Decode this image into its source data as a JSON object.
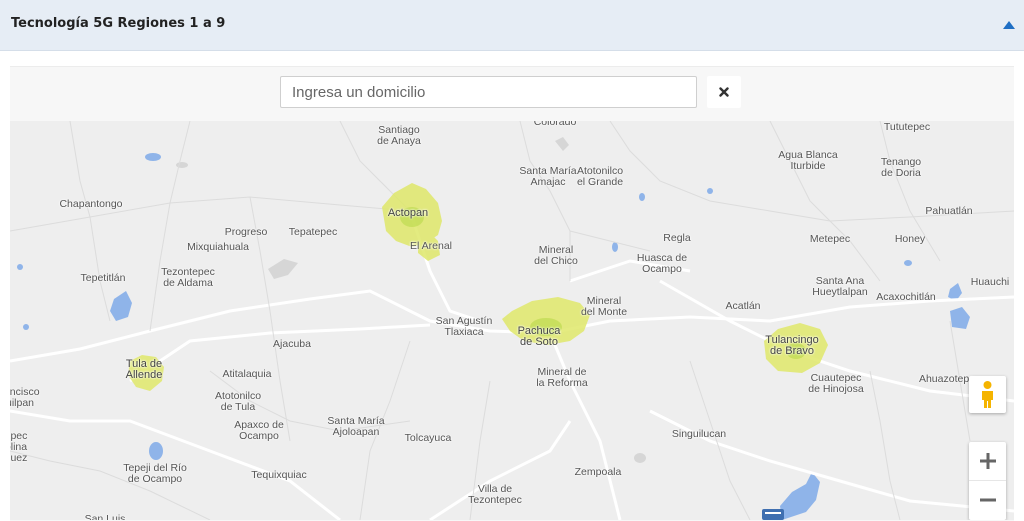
{
  "section": {
    "title": "Tecnología 5G Regiones 1 a 9"
  },
  "search": {
    "placeholder": "Ingresa un domicilio"
  },
  "map": {
    "coverage_color": "#d9e25a",
    "places": [
      {
        "name": "Santiago\nde Anaya",
        "kind": "town"
      },
      {
        "name": "Colorado",
        "kind": "town"
      },
      {
        "name": "Tututepec",
        "kind": "town"
      },
      {
        "name": "Agua Blanca\nIturbide",
        "kind": "town"
      },
      {
        "name": "Tenango\nde Doria",
        "kind": "town"
      },
      {
        "name": "Santa María\nAmajac",
        "kind": "town"
      },
      {
        "name": "Atotonilco\nel Grande",
        "kind": "town"
      },
      {
        "name": "Chapantongo",
        "kind": "town"
      },
      {
        "name": "Actopan",
        "kind": "city"
      },
      {
        "name": "Pahuatlán",
        "kind": "town"
      },
      {
        "name": "Progreso",
        "kind": "town"
      },
      {
        "name": "Tepatepec",
        "kind": "town"
      },
      {
        "name": "El Arenal",
        "kind": "town"
      },
      {
        "name": "Regla",
        "kind": "town"
      },
      {
        "name": "Metepec",
        "kind": "town"
      },
      {
        "name": "Honey",
        "kind": "town"
      },
      {
        "name": "Mixquiahuala",
        "kind": "town"
      },
      {
        "name": "Mineral\ndel Chico",
        "kind": "town"
      },
      {
        "name": "Huasca de\nOcampo",
        "kind": "town"
      },
      {
        "name": "Tepetitlán",
        "kind": "town"
      },
      {
        "name": "Tezontepec\nde Aldama",
        "kind": "town"
      },
      {
        "name": "Santa Ana\nHueytlalpan",
        "kind": "town"
      },
      {
        "name": "Huauchi",
        "kind": "town"
      },
      {
        "name": "Acaxochitlán",
        "kind": "town"
      },
      {
        "name": "Mineral\ndel Monte",
        "kind": "town"
      },
      {
        "name": "Acatlán",
        "kind": "town"
      },
      {
        "name": "San Agustín\nTlaxiaca",
        "kind": "town"
      },
      {
        "name": "Pachuca\nde Soto",
        "kind": "city"
      },
      {
        "name": "Ajacuba",
        "kind": "town"
      },
      {
        "name": "Tulancingo\nde Bravo",
        "kind": "city"
      },
      {
        "name": "Tula de\nAllende",
        "kind": "city"
      },
      {
        "name": "Mineral de\nla Reforma",
        "kind": "town"
      },
      {
        "name": "Atitalaquia",
        "kind": "town"
      },
      {
        "name": "Cuautepec\nde Hinojosa",
        "kind": "town"
      },
      {
        "name": "Ahuazotepe",
        "kind": "town"
      },
      {
        "name": "rancisco\nuilpan",
        "kind": "town"
      },
      {
        "name": "Atotonilco\nde Tula",
        "kind": "town"
      },
      {
        "name": "Apaxco de\nOcampo",
        "kind": "town"
      },
      {
        "name": "Santa María\nAjoloapan",
        "kind": "town"
      },
      {
        "name": "Tolcayuca",
        "kind": "town"
      },
      {
        "name": "Singuilucan",
        "kind": "town"
      },
      {
        "name": "epec\nolina\nquez",
        "kind": "town"
      },
      {
        "name": "Tepeji del Río\nde Ocampo",
        "kind": "town"
      },
      {
        "name": "Tequixquiac",
        "kind": "town"
      },
      {
        "name": "Zempoala",
        "kind": "town"
      },
      {
        "name": "Villa de\nTezontepec",
        "kind": "town"
      },
      {
        "name": "San Luis",
        "kind": "town"
      }
    ]
  }
}
